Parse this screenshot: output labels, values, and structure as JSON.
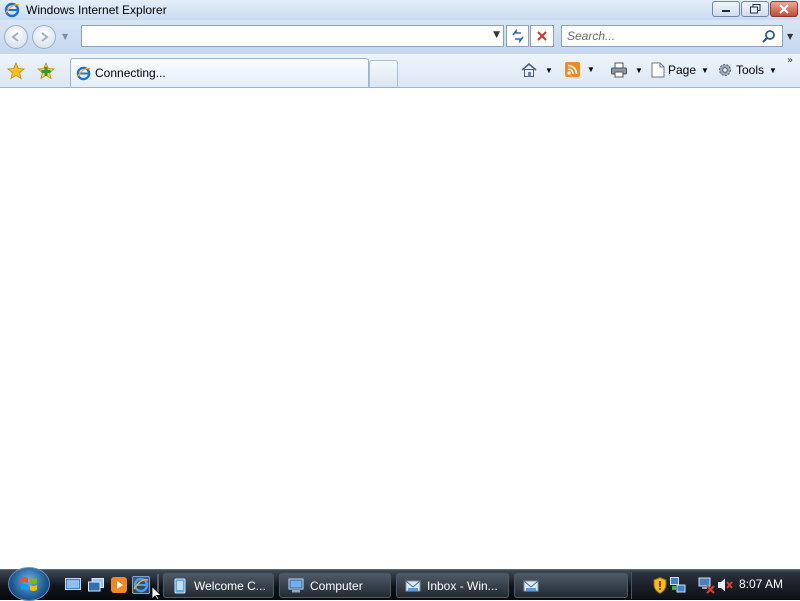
{
  "window": {
    "title": "Windows Internet Explorer",
    "controls": {
      "minimize": "minimize-icon",
      "restore": "restore-icon",
      "close": "close-icon"
    }
  },
  "navigation": {
    "back_icon": "back-arrow-icon",
    "forward_icon": "forward-arrow-icon",
    "address_value": "",
    "refresh_icon": "refresh-icon",
    "stop_icon": "stop-icon",
    "search": {
      "placeholder": "Search...",
      "value": ""
    }
  },
  "tabs": {
    "favorites_icon": "favorites-star-icon",
    "add_favorites_icon": "add-to-favorites-icon",
    "items": [
      {
        "label": "Connecting...",
        "icon": "ie-icon"
      }
    ],
    "new_tab_icon": "new-tab-icon"
  },
  "commands": {
    "home_icon": "home-icon",
    "feeds_icon": "feeds-icon",
    "print_icon": "print-icon",
    "page_label": "Page",
    "tools_label": "Tools",
    "more_icon": "chevron-more-icon"
  },
  "taskbar": {
    "start_icon": "windows-start-icon",
    "quick_launch": [
      "show-desktop-icon",
      "switch-windows-icon",
      "media-player-icon",
      "ie-icon"
    ],
    "buttons": [
      {
        "label": "Welcome C...",
        "icon": "welcome-center-icon"
      },
      {
        "label": "Computer",
        "icon": "computer-icon"
      },
      {
        "label": "Inbox - Win...",
        "icon": "mail-icon"
      },
      {
        "label": "",
        "icon": "mail-icon"
      }
    ],
    "tray_icons": [
      "security-shield-icon",
      "network-icon",
      "network-disconnected-icon",
      "volume-muted-icon"
    ],
    "clock": "8:07 AM"
  },
  "colors": {
    "titlebar": "#c9dcf1",
    "toolbar": "#d7e5f5",
    "taskbar": "#0f141b",
    "close_button": "#c24c34"
  }
}
